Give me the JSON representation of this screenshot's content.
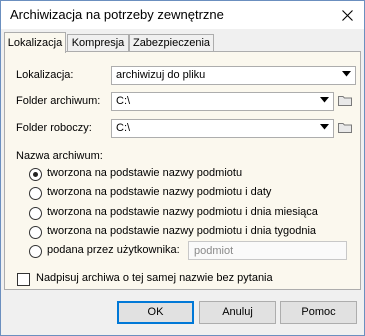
{
  "window": {
    "title": "Archiwizacja na potrzeby zewnętrzne"
  },
  "tabs": [
    {
      "label": "Lokalizacja",
      "active": true
    },
    {
      "label": "Kompresja",
      "active": false
    },
    {
      "label": "Zabezpieczenia",
      "active": false
    }
  ],
  "location": {
    "lokalizacja_label": "Lokalizacja:",
    "lokalizacja_value": "archiwizuj do pliku",
    "folder_archiwum_label": "Folder archiwum:",
    "folder_archiwum_value": "C:\\",
    "folder_roboczy_label": "Folder roboczy:",
    "folder_roboczy_value": "C:\\"
  },
  "archive_name": {
    "group_label": "Nazwa archiwum:",
    "options": [
      {
        "label": "tworzona na podstawie nazwy podmiotu",
        "selected": true
      },
      {
        "label": "tworzona na podstawie nazwy podmiotu i daty",
        "selected": false
      },
      {
        "label": "tworzona na podstawie nazwy podmiotu i dnia miesiąca",
        "selected": false
      },
      {
        "label": "tworzona na podstawie nazwy podmiotu i dnia tygodnia",
        "selected": false
      },
      {
        "label": "podana przez użytkownika:",
        "selected": false
      }
    ],
    "user_input_placeholder": "podmiot"
  },
  "overwrite": {
    "label": "Nadpisuj archiwa o tej samej nazwie bez pytania",
    "checked": false
  },
  "buttons": {
    "ok": "OK",
    "cancel": "Anuluj",
    "help": "Pomoc"
  },
  "colors": {
    "panel_bg": "#fbf8ee",
    "dialog_bg": "#f0f0f0",
    "accent_border": "#0078d7"
  }
}
